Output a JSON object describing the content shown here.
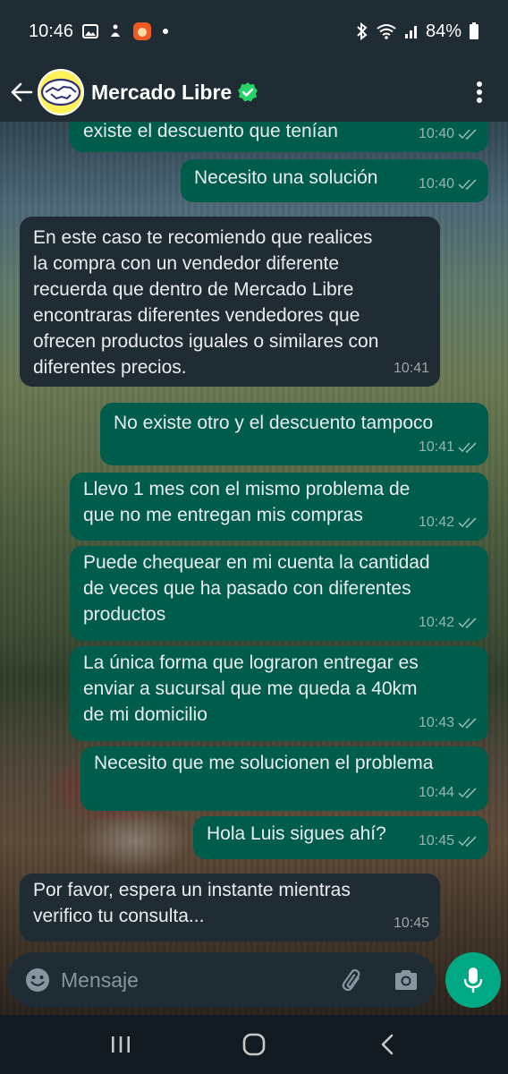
{
  "status_bar": {
    "time": "10:46",
    "battery": "84%",
    "icons": [
      "image-icon",
      "accessibility-icon",
      "app-notification-icon",
      "dot-icon",
      "bluetooth-icon",
      "wifi-icon",
      "signal-icon",
      "battery-icon"
    ]
  },
  "header": {
    "contact_name": "Mercado Libre",
    "verified": true,
    "avatar_icon": "handshake-logo",
    "accent_color": "#00a884"
  },
  "messages": [
    {
      "direction": "out",
      "text": "existe el descuento que tenían",
      "time": "10:40",
      "read": true
    },
    {
      "direction": "out",
      "text": "Necesito una solución",
      "time": "10:40",
      "read": true
    },
    {
      "direction": "in",
      "text": "En este caso te recomiendo que realices\nla compra con un vendedor diferente\nrecuerda que dentro de Mercado Libre\nencontraras diferentes vendedores que\nofrecen productos iguales o similares con\ndiferentes precios.",
      "time": "10:41"
    },
    {
      "direction": "out",
      "text": "No existe otro y el descuento tampoco",
      "time": "10:41",
      "read": true
    },
    {
      "direction": "out",
      "text": "Llevo 1 mes con el mismo problema de\nque no me entregan mis compras",
      "time": "10:42",
      "read": true
    },
    {
      "direction": "out",
      "text": "Puede chequear en mi cuenta la cantidad\nde veces que ha pasado con diferentes\nproductos",
      "time": "10:42",
      "read": true
    },
    {
      "direction": "out",
      "text": "La única forma que lograron entregar es\nenviar a sucursal que me queda a 40km\nde mi domicilio",
      "time": "10:43",
      "read": true
    },
    {
      "direction": "out",
      "text": "Necesito que me solucionen el problema",
      "time": "10:44",
      "read": true
    },
    {
      "direction": "out",
      "text": "Hola Luis sigues ahí?",
      "time": "10:45",
      "read": true
    },
    {
      "direction": "in",
      "text": "Por favor, espera un instante mientras\nverifico tu consulta...",
      "time": "10:45"
    }
  ],
  "composer": {
    "placeholder": "Mensaje",
    "icons": [
      "emoji-icon",
      "paperclip-icon",
      "camera-icon",
      "microphone-icon"
    ]
  },
  "nav_bar": {
    "buttons": [
      "recent-apps",
      "home",
      "back"
    ]
  }
}
